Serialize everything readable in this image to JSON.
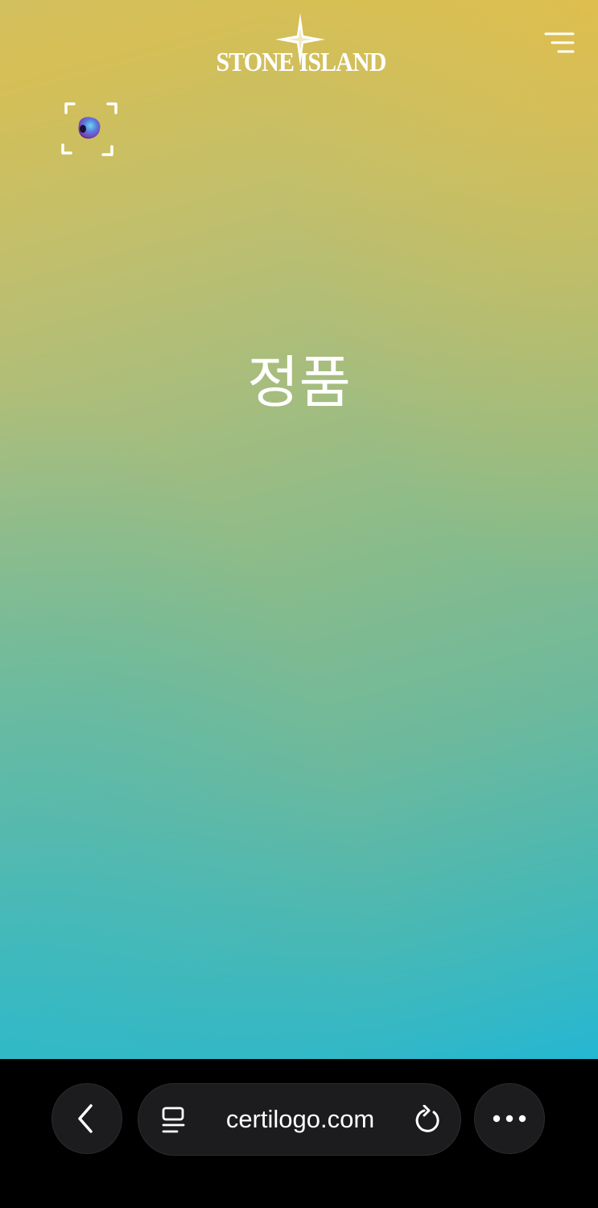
{
  "header": {
    "brand": "STONE ISLAND",
    "menu_icon": "menu-lines-icon",
    "scan_icon": "scan-frame-icon"
  },
  "main": {
    "status": "정품"
  },
  "browser": {
    "url": "certilogo.com",
    "back_icon": "chevron-left-icon",
    "reader_icon": "reader-mode-icon",
    "reload_icon": "reload-icon",
    "more_icon": "more-dots-icon"
  },
  "colors": {
    "gradient_top": "#d6bf55",
    "gradient_mid": "#86bb8c",
    "gradient_bottom": "#25b7d2",
    "browser_bar": "#000000",
    "button_fill": "#1c1c1e",
    "text": "#ffffff"
  }
}
